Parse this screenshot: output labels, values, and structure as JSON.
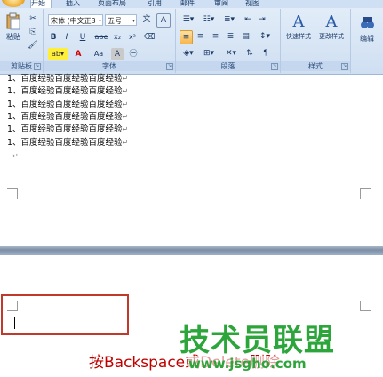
{
  "tabs": [
    "开始",
    "插入",
    "页面布局",
    "引用",
    "邮件",
    "审阅",
    "视图"
  ],
  "clipboard": {
    "paste": "粘贴",
    "label": "剪贴板"
  },
  "font": {
    "name": "宋体 (中文正3",
    "size": "五号",
    "label": "字体",
    "bold": "B",
    "italic": "I",
    "underline": "U",
    "strike": "abe",
    "sub": "x₂",
    "sup": "x²",
    "clear": "A",
    "change_case": "Aa",
    "char_border": "A",
    "phonetic": "文",
    "grow": "A",
    "shrink": "A"
  },
  "paragraph": {
    "label": "段落"
  },
  "styles": {
    "quick": "快速样式",
    "change": "更改样式",
    "label": "样式"
  },
  "editing": {
    "label": "编辑"
  },
  "doc": {
    "lines": [
      "1、百度经验百度经验百度经验",
      "1、百度经验百度经验百度经验",
      "1、百度经验百度经验百度经验",
      "1、百度经验百度经验百度经验",
      "1、百度经验百度经验百度经验",
      "1、百度经验百度经验百度经验"
    ],
    "para_mark": "↵",
    "caption": "按Backspace或Delete删除",
    "watermark": "技术员联盟",
    "watermark_url": "www.jsgho.com"
  },
  "colors": {
    "highlight": "#c0392b",
    "watermark_green": "#2ca53a",
    "caption_red": "#c00000"
  }
}
